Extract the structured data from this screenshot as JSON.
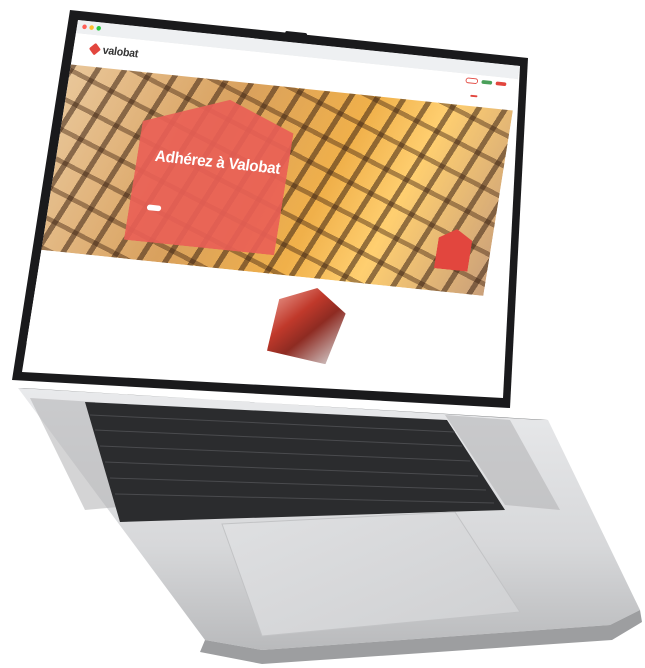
{
  "site": {
    "logo_text": "valobat",
    "logo_tagline": "",
    "header_links": [
      "",
      ""
    ],
    "buttons": [
      "",
      "",
      ""
    ],
    "nav_items": [
      "",
      "",
      "",
      "",
      "",
      ""
    ]
  },
  "hero": {
    "title": "Adhérez à Valobat",
    "subtitle": "",
    "cta": "",
    "badge": ""
  },
  "section": {
    "title": "",
    "text": ""
  },
  "colors": {
    "brand_red": "#e2463e",
    "accent_green": "#4aa05a"
  }
}
